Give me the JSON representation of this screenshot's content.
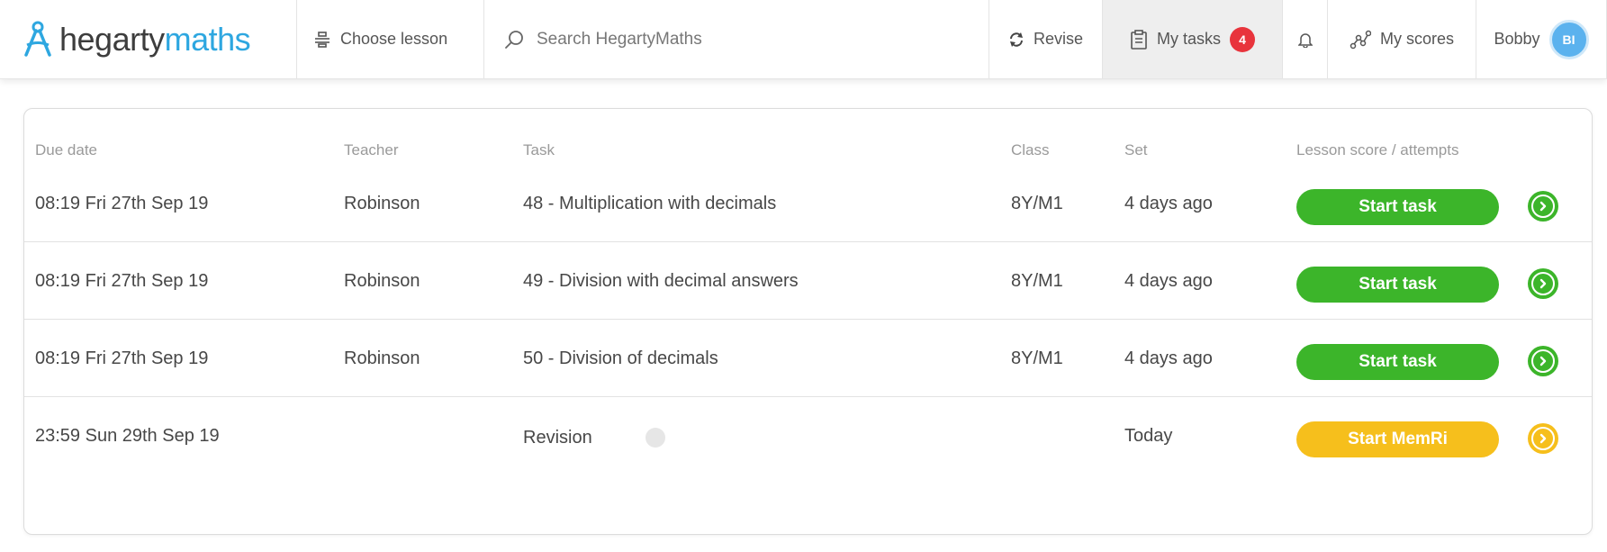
{
  "app": {
    "logo_part1": "hegarty",
    "logo_part2": "maths",
    "brand_color": "#2ea7e0"
  },
  "nav": {
    "choose_lesson": "Choose lesson",
    "search_placeholder": "Search HegartyMaths",
    "revise": "Revise",
    "my_tasks": "My tasks",
    "tasks_badge": "4",
    "my_scores": "My scores",
    "user_name": "Bobby",
    "user_initials": "BI"
  },
  "table": {
    "headers": {
      "due_date": "Due date",
      "teacher": "Teacher",
      "task": "Task",
      "class": "Class",
      "set": "Set",
      "score": "Lesson score / attempts"
    },
    "rows": [
      {
        "due": "08:19 Fri 27th Sep 19",
        "teacher": "Robinson",
        "task": "48 - Multiplication with decimals",
        "class": "8Y/M1",
        "set": "4 days ago",
        "button": "Start task"
      },
      {
        "due": "08:19 Fri 27th Sep 19",
        "teacher": "Robinson",
        "task": "49 - Division with decimal answers",
        "class": "8Y/M1",
        "set": "4 days ago",
        "button": "Start task"
      },
      {
        "due": "08:19 Fri 27th Sep 19",
        "teacher": "Robinson",
        "task": "50 - Division of decimals",
        "class": "8Y/M1",
        "set": "4 days ago",
        "button": "Start task"
      },
      {
        "due": "23:59 Sun 29th Sep 19",
        "teacher": "",
        "task": "Revision",
        "class": "",
        "set": "Today",
        "button": "Start MemRi"
      }
    ]
  },
  "colors": {
    "start_task": "#3cb52a",
    "start_memri": "#f6bf1c",
    "badge": "#e8343c",
    "avatar": "#5bb2ee"
  }
}
